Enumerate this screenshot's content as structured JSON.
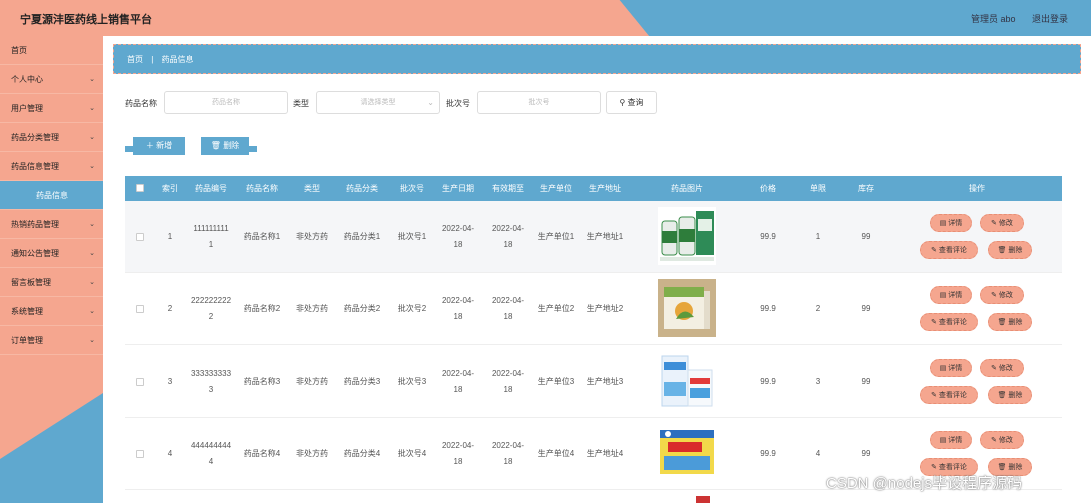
{
  "header": {
    "title": "宁夏源沣医药线上销售平台",
    "user": "管理员 abo",
    "logout": "退出登录"
  },
  "sidebar": {
    "items": [
      {
        "label": "首页",
        "chev": false
      },
      {
        "label": "个人中心",
        "chev": true
      },
      {
        "label": "用户管理",
        "chev": true
      },
      {
        "label": "药品分类管理",
        "chev": true
      },
      {
        "label": "药品信息管理",
        "chev": true
      },
      {
        "label": "药品信息",
        "chev": false,
        "sub": true
      },
      {
        "label": "热销药品管理",
        "chev": true
      },
      {
        "label": "通知公告管理",
        "chev": true
      },
      {
        "label": "留言板管理",
        "chev": true
      },
      {
        "label": "系统管理",
        "chev": true
      },
      {
        "label": "订单管理",
        "chev": true
      }
    ],
    "chev_glyph": "⌄"
  },
  "breadcrumb": {
    "home": "首页",
    "sep": "|",
    "current": "药品信息"
  },
  "search": {
    "name_label": "药品名称",
    "name_placeholder": "药品名称",
    "type_label": "类型",
    "type_placeholder": "请选择类型",
    "batch_label": "批次号",
    "batch_placeholder": "批次号",
    "button_label": "查询"
  },
  "actions": {
    "add_label": "新增",
    "delete_label": "删除"
  },
  "table": {
    "headers": [
      "索引",
      "药品编号",
      "药品名称",
      "类型",
      "药品分类",
      "批次号",
      "生产日期",
      "有效期至",
      "生产单位",
      "生产地址",
      "药品图片",
      "价格",
      "单限",
      "库存",
      "操作"
    ],
    "rows": [
      {
        "index": "1",
        "code_a": "111111111",
        "code_b": "1",
        "name": "药品名称1",
        "type": "非处方药",
        "category": "药品分类1",
        "batch": "批次号1",
        "prod_a": "2022-04-",
        "prod_b": "18",
        "exp_a": "2022-04-",
        "exp_b": "18",
        "unit": "生产单位1",
        "addr": "生产地址1",
        "price": "99.9",
        "limit": "1",
        "stock": "99"
      },
      {
        "index": "2",
        "code_a": "222222222",
        "code_b": "2",
        "name": "药品名称2",
        "type": "非处方药",
        "category": "药品分类2",
        "batch": "批次号2",
        "prod_a": "2022-04-",
        "prod_b": "18",
        "exp_a": "2022-04-",
        "exp_b": "18",
        "unit": "生产单位2",
        "addr": "生产地址2",
        "price": "99.9",
        "limit": "2",
        "stock": "99"
      },
      {
        "index": "3",
        "code_a": "333333333",
        "code_b": "3",
        "name": "药品名称3",
        "type": "非处方药",
        "category": "药品分类3",
        "batch": "批次号3",
        "prod_a": "2022-04-",
        "prod_b": "18",
        "exp_a": "2022-04-",
        "exp_b": "18",
        "unit": "生产单位3",
        "addr": "生产地址3",
        "price": "99.9",
        "limit": "3",
        "stock": "99"
      },
      {
        "index": "4",
        "code_a": "444444444",
        "code_b": "4",
        "name": "药品名称4",
        "type": "非处方药",
        "category": "药品分类4",
        "batch": "批次号4",
        "prod_a": "2022-04-",
        "prod_b": "18",
        "exp_a": "2022-04-",
        "exp_b": "18",
        "unit": "生产单位4",
        "addr": "生产地址4",
        "price": "99.9",
        "limit": "4",
        "stock": "99"
      }
    ],
    "op_detail": "详情",
    "op_edit": "修改",
    "op_comments": "查看评论",
    "op_delete": "删除"
  },
  "watermark": "CSDN @nodejs毕设程序源码",
  "colors": {
    "accent": "#5fa8cf",
    "salmon": "#f5a68f"
  }
}
